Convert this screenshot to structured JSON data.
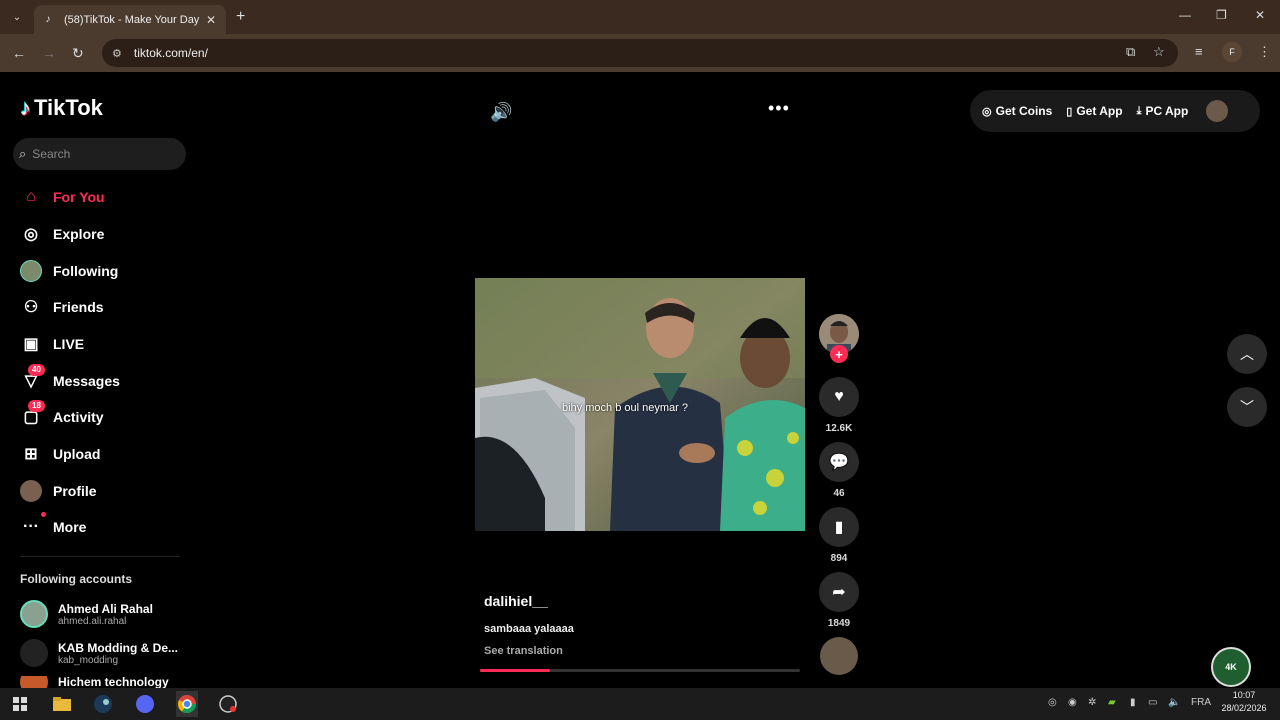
{
  "browser": {
    "tab_title": "(58)TikTok - Make Your Day",
    "url": "tiktok.com/en/"
  },
  "tiktok": {
    "logo_text": "TikTok",
    "search_placeholder": "Search",
    "menu": [
      {
        "label": "For You",
        "icon": "home-icon",
        "active": true
      },
      {
        "label": "Explore",
        "icon": "compass-icon"
      },
      {
        "label": "Following",
        "icon": "following-avatar"
      },
      {
        "label": "Friends",
        "icon": "friends-icon"
      },
      {
        "label": "LIVE",
        "icon": "live-icon"
      },
      {
        "label": "Messages",
        "icon": "messages-icon",
        "badge": "40"
      },
      {
        "label": "Activity",
        "icon": "activity-icon",
        "badge": "18"
      },
      {
        "label": "Upload",
        "icon": "upload-icon"
      },
      {
        "label": "Profile",
        "icon": "profile-avatar"
      },
      {
        "label": "More",
        "icon": "more-icon"
      }
    ],
    "following_title": "Following accounts",
    "accounts": [
      {
        "name": "Ahmed Ali Rahal",
        "handle": "ahmed.ali.rahal"
      },
      {
        "name": "KAB Modding & De...",
        "handle": "kab_modding"
      },
      {
        "name": "Hichem technology",
        "handle": ""
      }
    ],
    "top_actions": {
      "coins": "Get Coins",
      "app": "Get App",
      "pc_app": "PC App"
    },
    "video": {
      "subtitle": "bihy moch b oul neymar ?",
      "author": "dalihiel__",
      "caption": "sambaaa yalaaaa",
      "see_translation": "See translation",
      "progress": 0.22
    },
    "stats": {
      "likes": "12.6K",
      "comments": "46",
      "saves": "894",
      "shares": "1849"
    },
    "badge_4k": "4K"
  },
  "taskbar": {
    "lang": "FRA",
    "time": "10:07",
    "date": "28/02/2026"
  }
}
